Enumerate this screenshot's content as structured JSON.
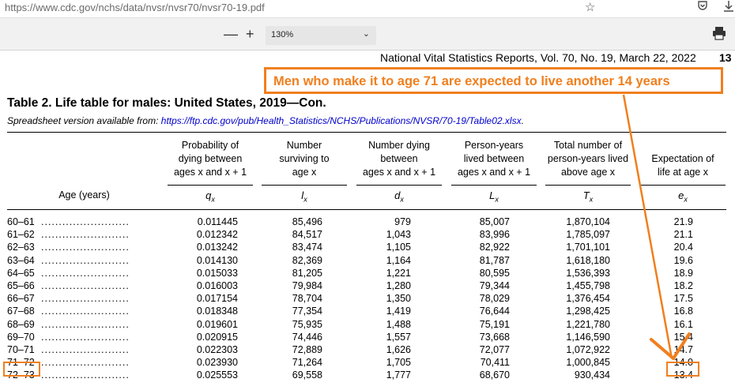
{
  "browser": {
    "url": "https://www.cdc.gov/nchs/data/nvsr/nvsr70/nvsr70-19.pdf",
    "zoom": "130%",
    "icons": [
      "star-icon",
      "pocket-icon",
      "download-icon",
      "zoom-out-icon",
      "zoom-in-icon",
      "print-icon"
    ],
    "zoom_out_label": "—",
    "zoom_in_label": "+"
  },
  "document": {
    "header": "National Vital Statistics Reports, Vol. 70, No. 19, March 22, 2022",
    "page_number": "13",
    "table_title": "Table 2. Life table for males: United States, 2019—Con.",
    "subtitle_prefix": "Spreadsheet version available from: ",
    "subtitle_link": "https://ftp.cdc.gov/pub/Health_Statistics/NCHS/Publications/NVSR/70-19/Table02.xlsx",
    "subtitle_suffix": ".",
    "columns": {
      "age": "Age (years)",
      "q": {
        "l1": "Probability of",
        "l2": "dying between",
        "l3": "ages x and x + 1",
        "sym": "q",
        "sub": "x"
      },
      "l": {
        "l1": "Number",
        "l2": "surviving to",
        "l3": "age x",
        "sym": "l",
        "sub": "x"
      },
      "d": {
        "l1": "Number dying",
        "l2": "between",
        "l3": "ages x and x + 1",
        "sym": "d",
        "sub": "x"
      },
      "L": {
        "l1": "Person-years",
        "l2": "lived between",
        "l3": "ages x and x + 1",
        "sym": "L",
        "sub": "x"
      },
      "T": {
        "l1": "Total number of",
        "l2": "person-years lived",
        "l3": "above age x",
        "sym": "T",
        "sub": "x"
      },
      "e": {
        "l1": "Expectation of",
        "l2": "life at age x",
        "sym": "e",
        "sub": "x"
      }
    },
    "rows": [
      {
        "age": "60–61",
        "q": "0.011445",
        "l": "85,496",
        "d": "979",
        "L": "85,007",
        "T": "1,870,104",
        "e": "21.9"
      },
      {
        "age": "61–62",
        "q": "0.012342",
        "l": "84,517",
        "d": "1,043",
        "L": "83,996",
        "T": "1,785,097",
        "e": "21.1"
      },
      {
        "age": "62–63",
        "q": "0.013242",
        "l": "83,474",
        "d": "1,105",
        "L": "82,922",
        "T": "1,701,101",
        "e": "20.4"
      },
      {
        "age": "63–64",
        "q": "0.014130",
        "l": "82,369",
        "d": "1,164",
        "L": "81,787",
        "T": "1,618,180",
        "e": "19.6"
      },
      {
        "age": "64–65",
        "q": "0.015033",
        "l": "81,205",
        "d": "1,221",
        "L": "80,595",
        "T": "1,536,393",
        "e": "18.9"
      },
      {
        "age": "65–66",
        "q": "0.016003",
        "l": "79,984",
        "d": "1,280",
        "L": "79,344",
        "T": "1,455,798",
        "e": "18.2"
      },
      {
        "age": "66–67",
        "q": "0.017154",
        "l": "78,704",
        "d": "1,350",
        "L": "78,029",
        "T": "1,376,454",
        "e": "17.5"
      },
      {
        "age": "67–68",
        "q": "0.018348",
        "l": "77,354",
        "d": "1,419",
        "L": "76,644",
        "T": "1,298,425",
        "e": "16.8"
      },
      {
        "age": "68–69",
        "q": "0.019601",
        "l": "75,935",
        "d": "1,488",
        "L": "75,191",
        "T": "1,221,780",
        "e": "16.1"
      },
      {
        "age": "69–70",
        "q": "0.020915",
        "l": "74,446",
        "d": "1,557",
        "L": "73,668",
        "T": "1,146,590",
        "e": "15.4"
      },
      {
        "age": "70–71",
        "q": "0.022303",
        "l": "72,889",
        "d": "1,626",
        "L": "72,077",
        "T": "1,072,922",
        "e": "14.7"
      },
      {
        "age": "71–72",
        "q": "0.023930",
        "l": "71,264",
        "d": "1,705",
        "L": "70,411",
        "T": "1,000,845",
        "e": "14.0"
      },
      {
        "age": "72–73",
        "q": "0.025553",
        "l": "69,558",
        "d": "1,777",
        "L": "68,670",
        "T": "930,434",
        "e": "13.4"
      }
    ]
  },
  "annotation": {
    "callout": "Men who make it to age 71 are expected to live another 14 years",
    "color": "#f07f1e"
  }
}
